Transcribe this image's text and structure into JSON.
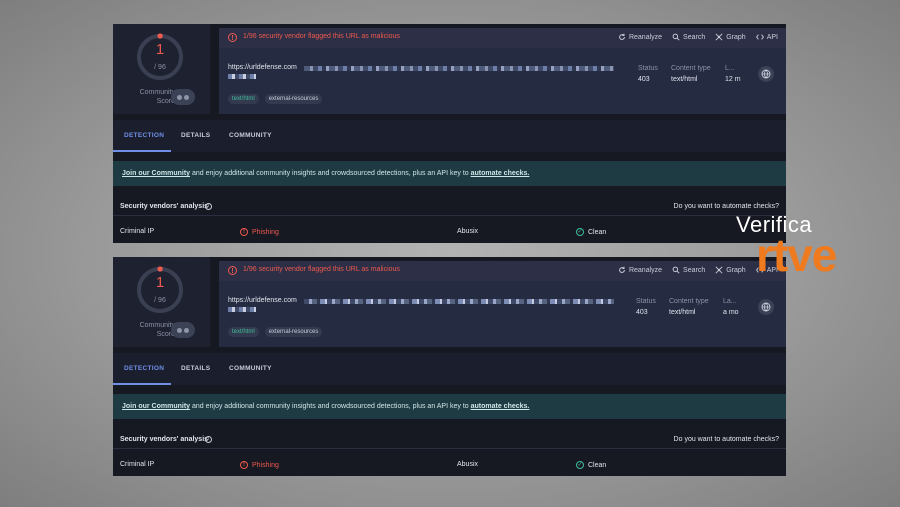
{
  "screenshots": [
    {
      "score": {
        "value": "1",
        "total": "/ 96",
        "label_line1": "Community",
        "label_line2": "Score"
      },
      "alert": "1/96 security vendor flagged this URL as malicious",
      "actions": [
        "Reanalyze",
        "Search",
        "Graph",
        "API"
      ],
      "url": "https://urldefense.com",
      "tags": [
        "text/html",
        "external-resources"
      ],
      "meta": [
        {
          "label": "Status",
          "value": "403"
        },
        {
          "label": "Content type",
          "value": "text/html"
        },
        {
          "label": "L...",
          "value": "12 m"
        }
      ],
      "tabs": [
        "DETECTION",
        "DETAILS",
        "COMMUNITY"
      ],
      "banner": {
        "link1": "Join our Community",
        "middle": " and enjoy additional community insights and crowdsourced detections, plus an API key to ",
        "link2": "automate checks."
      },
      "analysis": {
        "title": "Security vendors' analysis",
        "question": "Do you want to automate checks?"
      },
      "vendors": [
        {
          "name": "Criminal IP",
          "result": "Phishing"
        },
        {
          "name": "Abusix",
          "result": "Clean"
        }
      ]
    },
    {
      "score": {
        "value": "1",
        "total": "/ 96",
        "label_line1": "Community",
        "label_line2": "Score"
      },
      "alert": "1/96 security vendor flagged this URL as malicious",
      "actions": [
        "Reanalyze",
        "Search",
        "Graph",
        "API"
      ],
      "url": "https://urldefense.com",
      "tags": [
        "text/html",
        "external-resources"
      ],
      "meta": [
        {
          "label": "Status",
          "value": "403"
        },
        {
          "label": "Content type",
          "value": "text/html"
        },
        {
          "label": "La...",
          "value": "a mo"
        }
      ],
      "tabs": [
        "DETECTION",
        "DETAILS",
        "COMMUNITY"
      ],
      "banner": {
        "link1": "Join our Community",
        "middle": " and enjoy additional community insights and crowdsourced detections, plus an API key to ",
        "link2": "automate checks."
      },
      "analysis": {
        "title": "Security vendors' analysis",
        "question": "Do you want to automate checks?"
      },
      "vendors": [
        {
          "name": "Criminal IP",
          "result": "Phishing"
        },
        {
          "name": "Abusix",
          "result": "Clean"
        }
      ]
    }
  ],
  "watermark": {
    "line1": "Verifica",
    "line2": "rtve"
  },
  "colors": {
    "malicious": "#ef5a4f",
    "clean": "#3fbf9b",
    "accent": "#6f8fe8",
    "brand_orange": "#f07a1e"
  }
}
